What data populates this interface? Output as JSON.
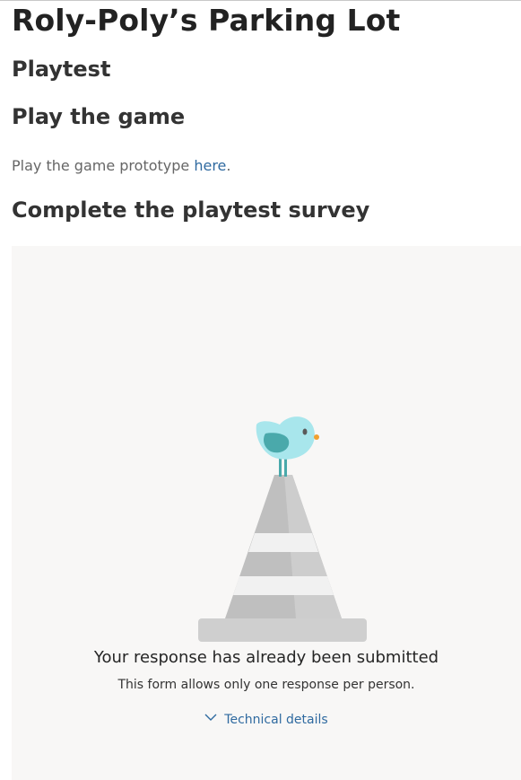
{
  "page": {
    "title": "Roly-Poly’s Parking Lot",
    "section_playtest": "Playtest",
    "section_play": "Play the game",
    "prototype_text": "Play the game prototype ",
    "prototype_link": "here",
    "prototype_suffix": ".",
    "section_survey": "Complete the playtest survey"
  },
  "form": {
    "submitted_title": "Your response has already been submitted",
    "submitted_subtitle": "This form allows only one response per person.",
    "technical_details": "Technical details",
    "technical_details_icon": "chevron-down-icon",
    "illustration": "bird-on-traffic-cone"
  },
  "colors": {
    "link": "#2f6aa0",
    "embed_background": "#f8f7f6",
    "bird": "#a8e6ec",
    "bird_wing": "#4aa9ab",
    "cone": "#bdbdbd"
  }
}
